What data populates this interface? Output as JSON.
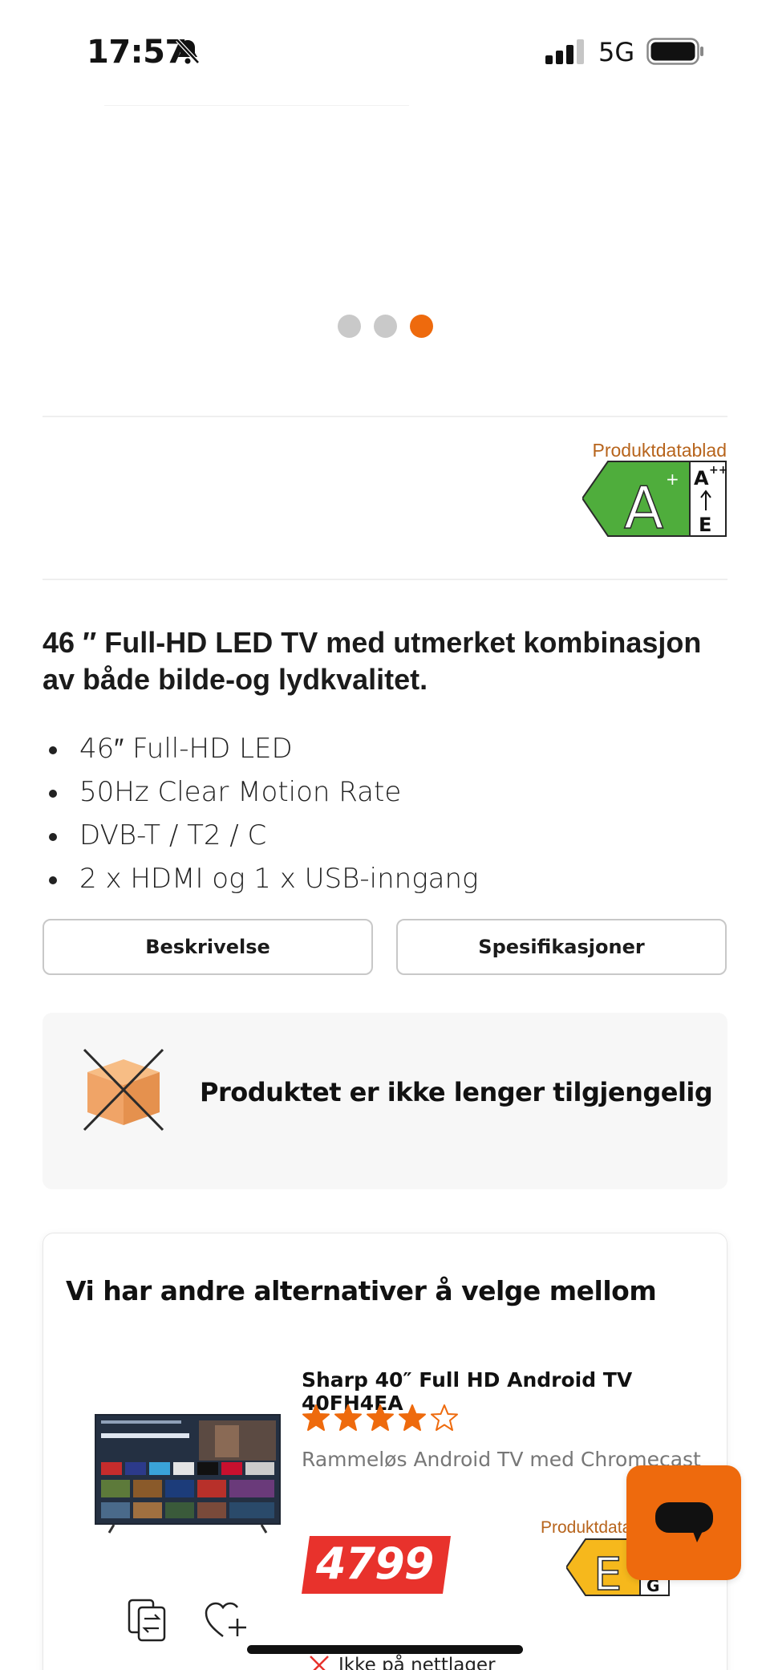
{
  "status_bar": {
    "time": "17:57",
    "network": "5G",
    "icons": [
      "bell-slash-icon",
      "signal-icon",
      "battery-icon"
    ]
  },
  "carousel": {
    "dot_count": 3,
    "active_index": 2
  },
  "energy_label": {
    "datasheet_link": "Produktdatablad",
    "class": "A",
    "class_suffix": "+",
    "scale_top": "A",
    "scale_top_suffix": "++",
    "scale_bottom": "E",
    "color": "#4fad3c"
  },
  "product": {
    "headline": "46 ″ Full-HD LED TV  med utmerket kombinasjon av både bilde-og lydkvalitet.",
    "features": [
      "46″ Full-HD LED",
      "50Hz Clear Motion Rate",
      "DVB-T / T2 / C",
      "2 x HDMI og 1 x USB-inngang"
    ]
  },
  "tabs": {
    "description_label": "Beskrivelse",
    "specifications_label": "Spesifikasjoner"
  },
  "availability": {
    "message": "Produktet er ikke lenger tilgjengelig",
    "icon": "unavailable-box-icon"
  },
  "alternatives": {
    "title": "Vi har andre alternativer å velge mellom",
    "item": {
      "name": "Sharp 40″ Full HD Android TV 40FH4EA",
      "rating": 4,
      "rating_max": 5,
      "description": "Rammeløs Android TV med Chromecast",
      "price": "4799",
      "datasheet_link": "Produktdatablad",
      "energy_class": "E",
      "energy_scale_bottom": "G",
      "energy_color": "#f6b81c",
      "stock_status": "Ikke på nettlager"
    }
  },
  "colors": {
    "accent": "#ee6a0d",
    "price_red": "#e8322c",
    "link_brown": "#b7641c"
  }
}
